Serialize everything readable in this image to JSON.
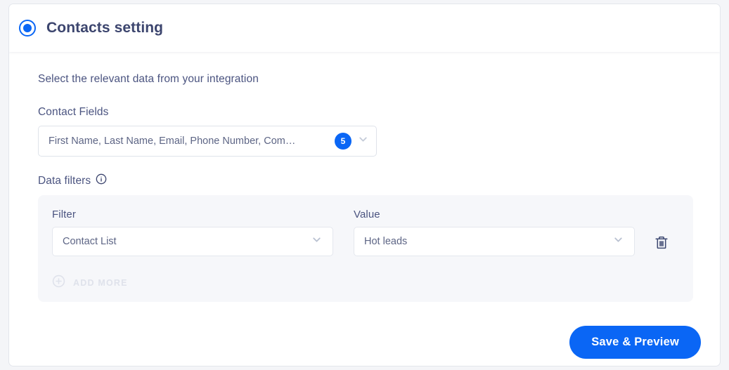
{
  "header": {
    "title": "Contacts setting",
    "radio_selected": true,
    "accent_color": "#0a66f5"
  },
  "body": {
    "lead_text": "Select the relevant data from your integration",
    "contact_fields": {
      "label": "Contact Fields",
      "value": "First Name, Last Name, Email, Phone Number, Com…",
      "count_badge": "5",
      "chevron_icon": "chevron-down-icon"
    },
    "data_filters": {
      "label": "Data filters",
      "info_icon": "info-circle-icon",
      "columns": {
        "filter_label": "Filter",
        "value_label": "Value"
      },
      "rows": [
        {
          "filter": "Contact List",
          "value": "Hot leads",
          "delete_icon": "trash-icon"
        }
      ],
      "add_more": {
        "label": "ADD MORE",
        "icon": "plus-circle-icon",
        "disabled": true
      }
    }
  },
  "footer": {
    "save_label": "Save & Preview"
  },
  "colors": {
    "accent": "#0a66f5",
    "text_primary": "#3c456e",
    "text_secondary": "#4b5480",
    "panel_bg": "#f6f7fa",
    "border": "#dfe3ea",
    "muted": "#dfe2eb"
  }
}
